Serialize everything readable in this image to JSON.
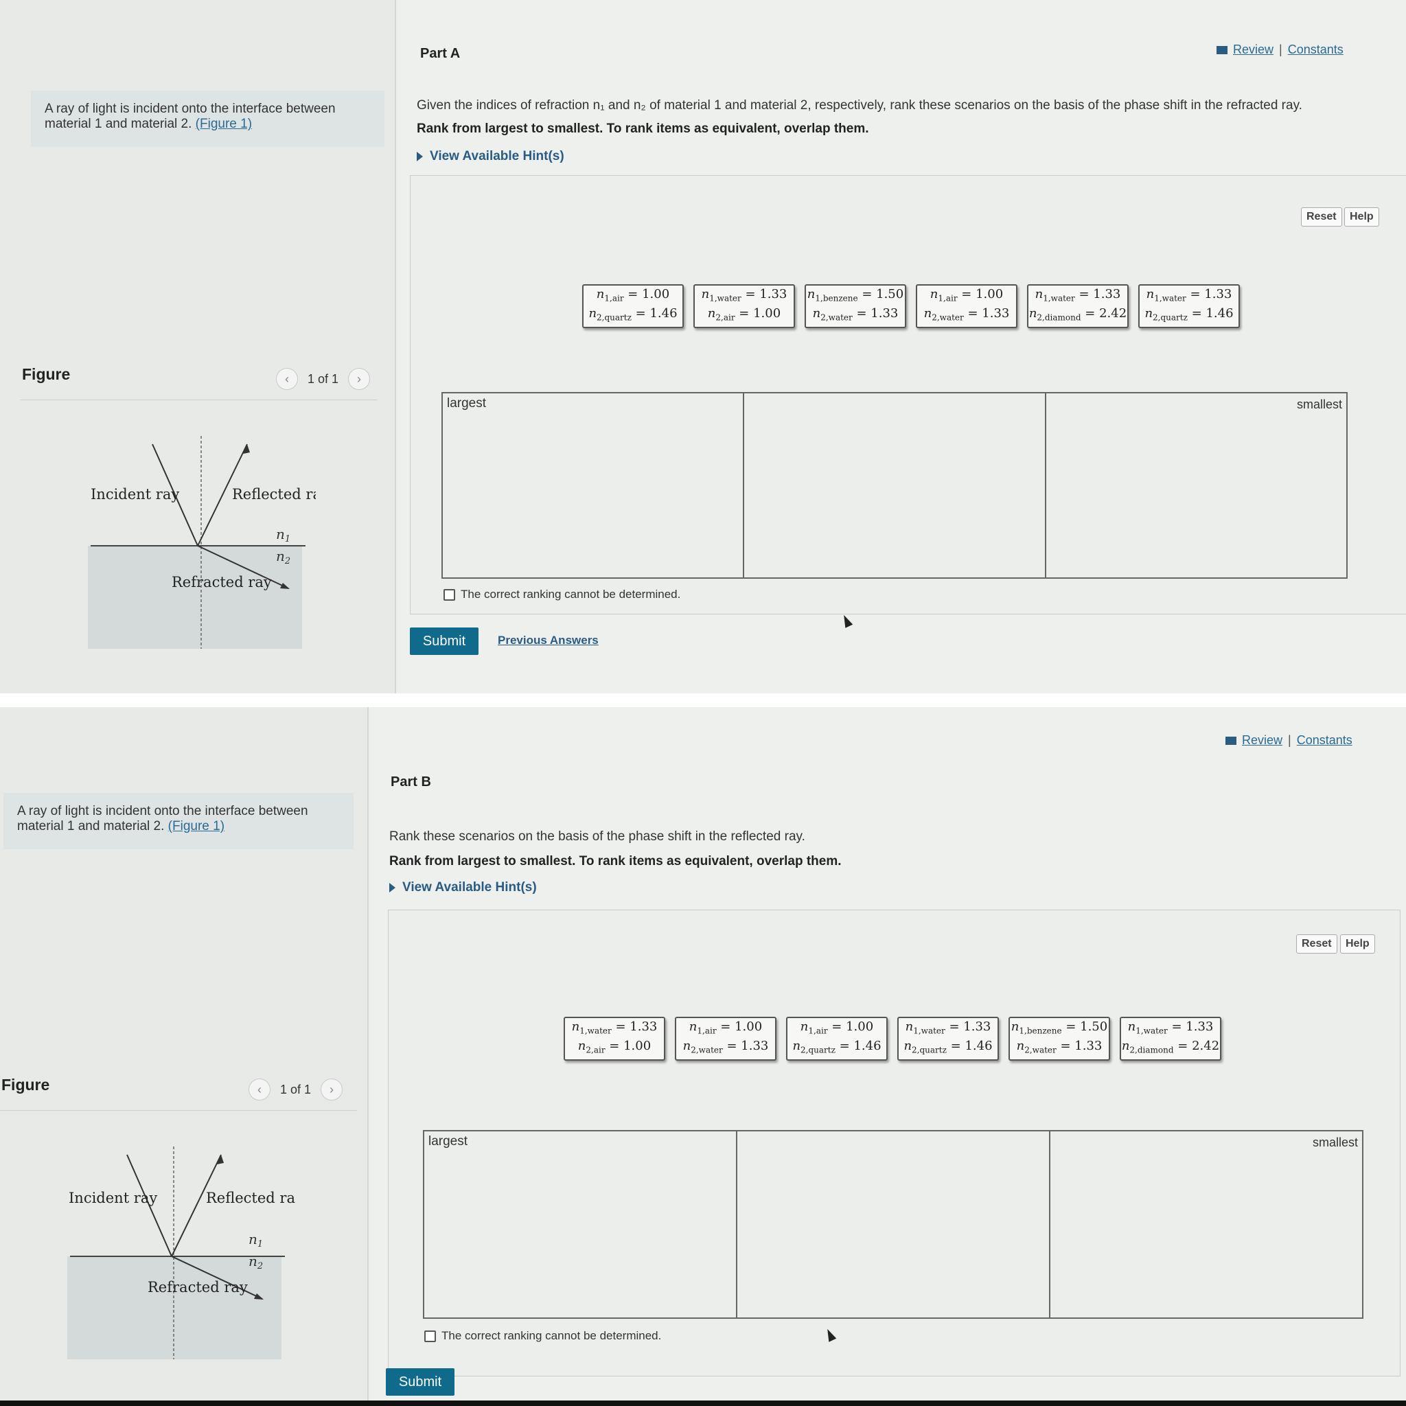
{
  "problem_text": "A ray of light is incident onto the interface between material 1 and material 2.",
  "figure_link": "(Figure 1)",
  "figure": {
    "title": "Figure",
    "pager": "1 of 1",
    "labels": {
      "incident": "Incident ray",
      "reflected": "Reflected ray",
      "refracted": "Refracted ray",
      "n1": "n",
      "n1_sub": "1",
      "n2": "n",
      "n2_sub": "2"
    }
  },
  "links": {
    "review": "Review",
    "sep": "|",
    "constants": "Constants"
  },
  "instruction": "Rank from largest to smallest. To rank items as equivalent, overlap them.",
  "hints_label": "View Available Hint(s)",
  "reset_label": "Reset",
  "help_label": "Help",
  "rank_largest": "largest",
  "rank_smallest": "smallest",
  "cannot_determine": "The correct ranking cannot be determined.",
  "submit_label": "Submit",
  "previous_answers": "Previous Answers",
  "part_a": {
    "title": "Part A",
    "question": "Given the indices of refraction n₁ and n₂ of material 1 and material 2, respectively, rank these scenarios on the basis of the phase shift in the refracted ray.",
    "chips": [
      {
        "m1": "air",
        "v1": "1.00",
        "m2": "quartz",
        "v2": "1.46"
      },
      {
        "m1": "water",
        "v1": "1.33",
        "m2": "air",
        "v2": "1.00"
      },
      {
        "m1": "benzene",
        "v1": "1.50",
        "m2": "water",
        "v2": "1.33"
      },
      {
        "m1": "air",
        "v1": "1.00",
        "m2": "water",
        "v2": "1.33"
      },
      {
        "m1": "water",
        "v1": "1.33",
        "m2": "diamond",
        "v2": "2.42"
      },
      {
        "m1": "water",
        "v1": "1.33",
        "m2": "quartz",
        "v2": "1.46"
      }
    ]
  },
  "part_b": {
    "title": "Part B",
    "question": "Rank these scenarios on the basis of the phase shift in the reflected ray.",
    "chips": [
      {
        "m1": "water",
        "v1": "1.33",
        "m2": "air",
        "v2": "1.00"
      },
      {
        "m1": "air",
        "v1": "1.00",
        "m2": "water",
        "v2": "1.33"
      },
      {
        "m1": "air",
        "v1": "1.00",
        "m2": "quartz",
        "v2": "1.46"
      },
      {
        "m1": "water",
        "v1": "1.33",
        "m2": "quartz",
        "v2": "1.46"
      },
      {
        "m1": "benzene",
        "v1": "1.50",
        "m2": "water",
        "v2": "1.33"
      },
      {
        "m1": "water",
        "v1": "1.33",
        "m2": "diamond",
        "v2": "2.42"
      }
    ]
  }
}
